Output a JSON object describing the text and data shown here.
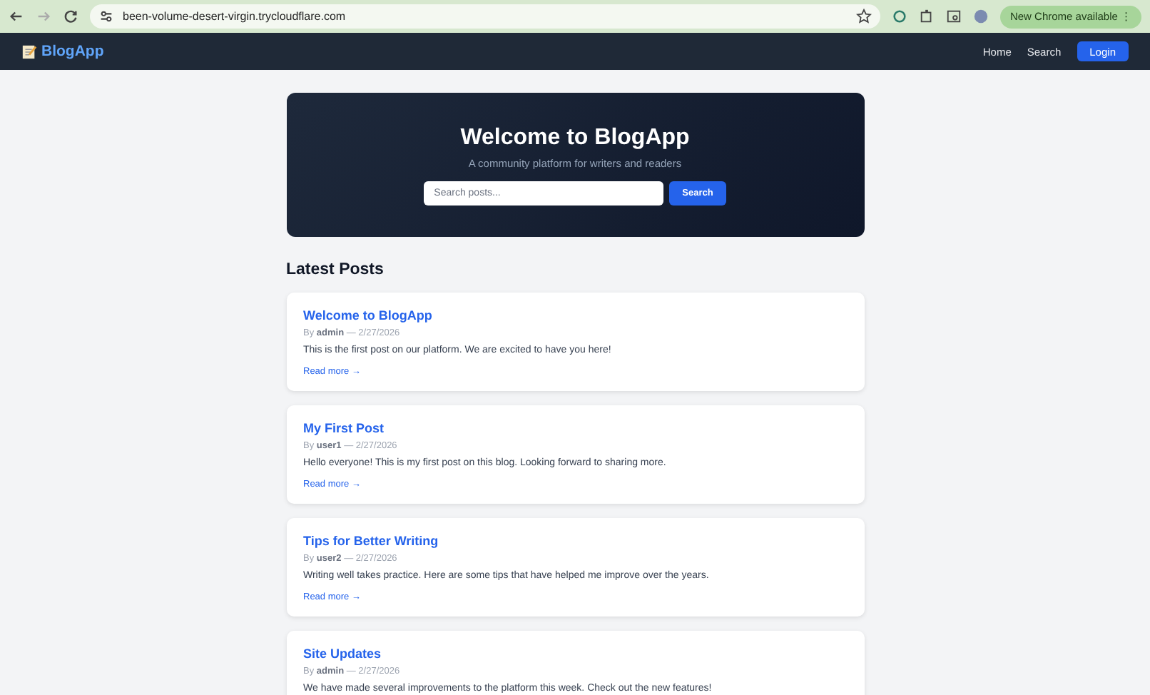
{
  "browser": {
    "url": "been-volume-desert-virgin.trycloudflare.com",
    "update_badge": "New Chrome available",
    "update_menu": "⋮"
  },
  "navbar": {
    "brand": "BlogApp",
    "links": [
      "Home",
      "Search"
    ],
    "login": "Login"
  },
  "hero": {
    "title": "Welcome to BlogApp",
    "subtitle": "A community platform for writers and readers",
    "search_placeholder": "Search posts...",
    "search_button": "Search"
  },
  "section_title": "Latest Posts",
  "posts": [
    {
      "title": "Welcome to BlogApp",
      "byline": "By **admin** — 2/27/2026",
      "excerpt": "This is the first post on our platform. We are excited to have you here!",
      "link": "Read more →"
    },
    {
      "title": "My First Post",
      "byline": "By **user1** — 2/27/2026",
      "excerpt": "Hello everyone! This is my first post on this blog. Looking forward to sharing more.",
      "link": "Read more →"
    },
    {
      "title": "Tips for Better Writing",
      "byline": "By **user2** — 2/27/2026",
      "excerpt": "Writing well takes practice. Here are some tips that have helped me improve over the years.",
      "link": "Read more →"
    },
    {
      "title": "Site Updates",
      "byline": "By **admin** — 2/27/2026",
      "excerpt": "We have made several improvements to the platform this week. Check out the new features!"
    }
  ]
}
